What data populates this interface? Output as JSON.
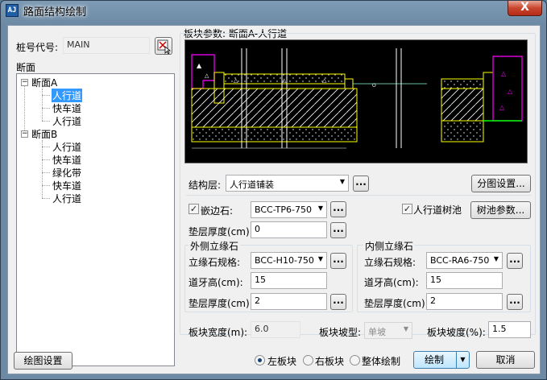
{
  "window": {
    "title": "路面结构绘制",
    "app_icon": "app-icon",
    "close_label": "X"
  },
  "pile": {
    "label": "桩号代号:",
    "value": "MAIN",
    "pick_icon": "pick-cursor-icon"
  },
  "tree": {
    "group_label": "断面",
    "sections": [
      {
        "name": "断面A",
        "children": [
          "人行道",
          "快车道",
          "人行道"
        ]
      },
      {
        "name": "断面B",
        "children": [
          "人行道",
          "快车道",
          "绿化带",
          "快车道",
          "人行道"
        ]
      }
    ]
  },
  "panel": {
    "title": "板块参数: 断面A-人行道",
    "structure_label": "结构层:",
    "structure_value": "人行道铺装",
    "split_button": "分图设置...",
    "edge_stone_label": "嵌边石:",
    "edge_stone_checked": true,
    "edge_stone_value": "BCC-TP6-750",
    "tree_pool_label": "人行道树池",
    "tree_pool_checked": true,
    "tree_pool_button": "树池参数...",
    "cushion_label": "垫层厚度(cm):",
    "cushion_value": "0",
    "ellipsis": "...",
    "outer": {
      "title": "外侧立缘石",
      "spec_label": "立缘石规格:",
      "spec_value": "BCC-H10-750",
      "curb_height_label": "道牙高(cm):",
      "curb_height_value": "15",
      "cushion_label": "垫层厚度(cm):",
      "cushion_value": "2"
    },
    "inner": {
      "title": "内侧立缘石",
      "spec_label": "立缘石规格:",
      "spec_value": "BCC-RA6-750",
      "curb_height_label": "道牙高(cm):",
      "curb_height_value": "15",
      "cushion_label": "垫层厚度(cm):",
      "cushion_value": "2"
    },
    "width_label": "板块宽度(m):",
    "width_value": "6.0",
    "slope_type_label": "板块坡型:",
    "slope_type_value": "单坡",
    "slope_label": "板块坡度(%):",
    "slope_value": "1.5"
  },
  "footer": {
    "draw_settings": "绘图设置",
    "radios": [
      {
        "label": "左板块",
        "checked": true
      },
      {
        "label": "右板块",
        "checked": false
      },
      {
        "label": "整体绘制",
        "checked": false
      }
    ],
    "draw_button": "绘制",
    "cancel_button": "取消"
  },
  "colors": {
    "preview_bg": "#000000",
    "layer_yellow": "#ffff00",
    "curb_magenta": "#ff00ff",
    "hatch_white": "#ffffff",
    "base_green": "#00ff00",
    "selection_blue": "#3399ff"
  }
}
